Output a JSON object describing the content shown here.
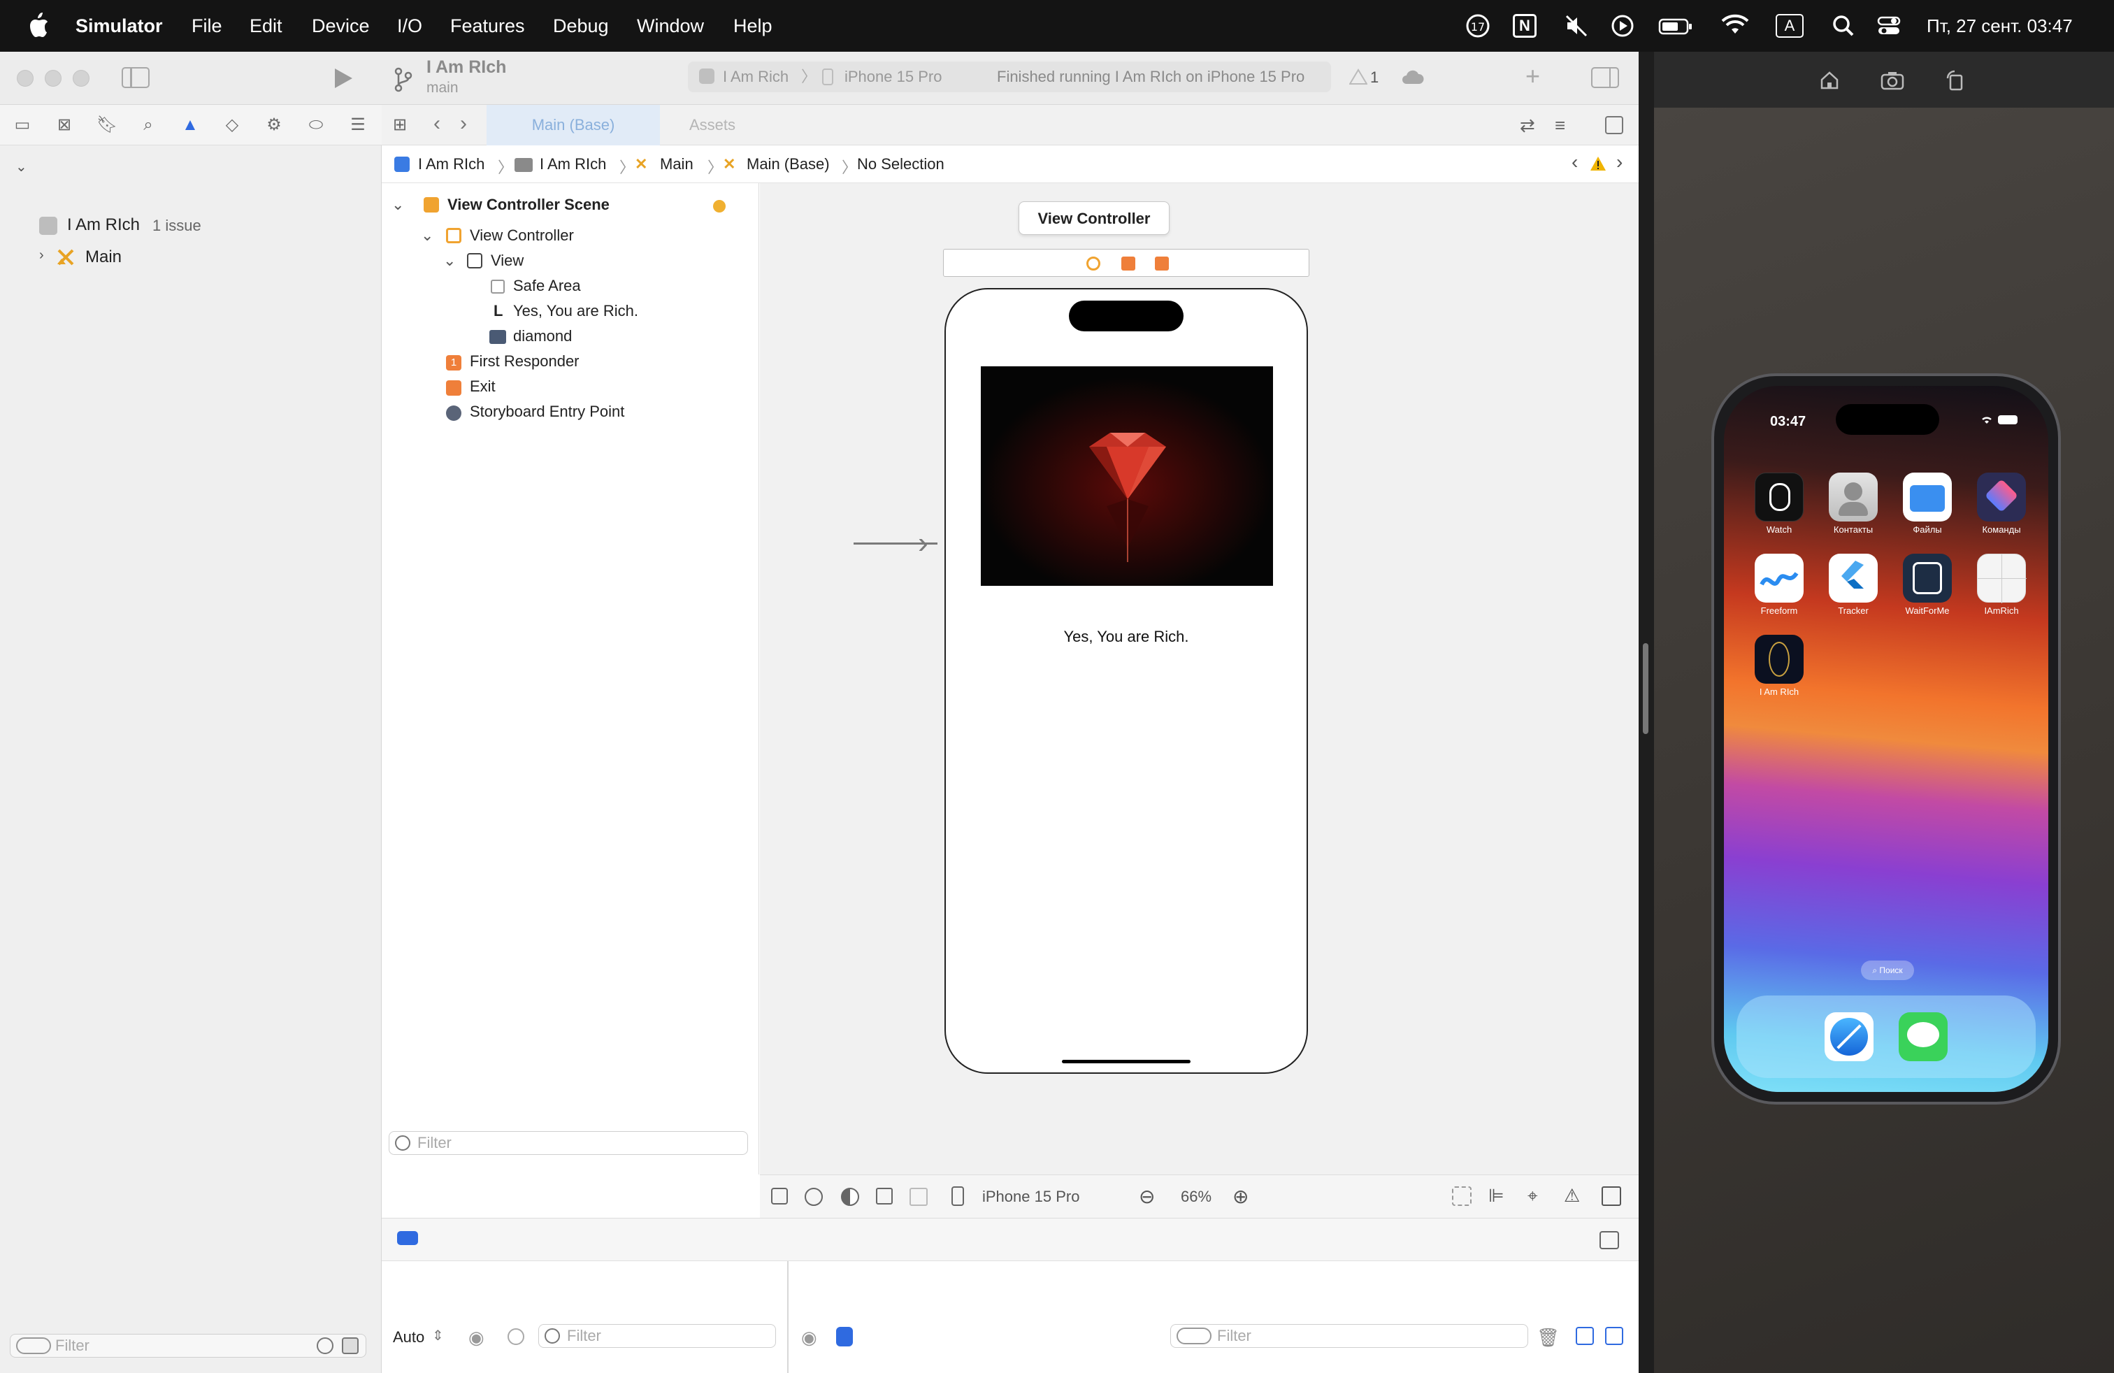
{
  "menubar": {
    "app_name": "Simulator",
    "items": [
      "File",
      "Edit",
      "Device",
      "I/O",
      "Features",
      "Debug",
      "Window",
      "Help"
    ],
    "datetime": "Пт, 27 сент.  03:47",
    "badge_count": "17",
    "input_source": "A"
  },
  "xcode": {
    "project_title": "I Am RIch",
    "branch": "main",
    "scheme": "I Am Rich",
    "destination": "iPhone 15 Pro",
    "status": "Finished running I Am RIch on iPhone 15 Pro",
    "warning_count": "1",
    "tabs": [
      "Main (Base)",
      "Assets"
    ],
    "breadcrumb": [
      "I Am RIch",
      "I Am RIch",
      "Main",
      "Main (Base)",
      "No Selection"
    ],
    "navigator": {
      "project": "I Am RIch",
      "issue": "1 issue",
      "file": "Main",
      "filter_placeholder": "Filter"
    },
    "outline": {
      "scene": "View Controller Scene",
      "items": [
        "View Controller",
        "View",
        "Safe Area",
        "Yes, You are Rich.",
        "diamond",
        "First Responder",
        "Exit",
        "Storyboard Entry Point"
      ],
      "filter_placeholder": "Filter"
    },
    "canvas": {
      "scene_title": "View Controller",
      "label_text": "Yes, You are Rich."
    },
    "bottom": {
      "device": "iPhone 15 Pro",
      "zoom": "66%"
    },
    "debug": {
      "mode": "Auto",
      "filter_placeholder": "Filter"
    }
  },
  "simulator": {
    "time": "03:47",
    "apps": [
      {
        "label": "Watch",
        "color": "#111111"
      },
      {
        "label": "Контакты",
        "color": "#c9c9c9"
      },
      {
        "label": "Файлы",
        "color": "#ffffff"
      },
      {
        "label": "Команды",
        "color": "#2c2c54"
      },
      {
        "label": "Freeform",
        "color": "#ffffff"
      },
      {
        "label": "Tracker",
        "color": "#ffffff"
      },
      {
        "label": "WaitForMe",
        "color": "#1d2d44"
      },
      {
        "label": "IAmRich",
        "color": "#f4f4f4"
      },
      {
        "label": "I Am RIch",
        "color": "#0b1020"
      }
    ],
    "search": "Поиск"
  }
}
